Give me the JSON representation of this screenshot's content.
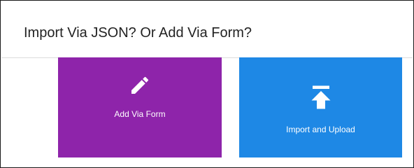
{
  "dialog": {
    "title": "Import Via JSON? Or Add Via Form?"
  },
  "options": [
    {
      "label": "Add Via Form",
      "icon": "pencil-icon",
      "color": "#8e24aa"
    },
    {
      "label": "Import and Upload",
      "icon": "upload-icon",
      "color": "#1e88e5"
    }
  ]
}
